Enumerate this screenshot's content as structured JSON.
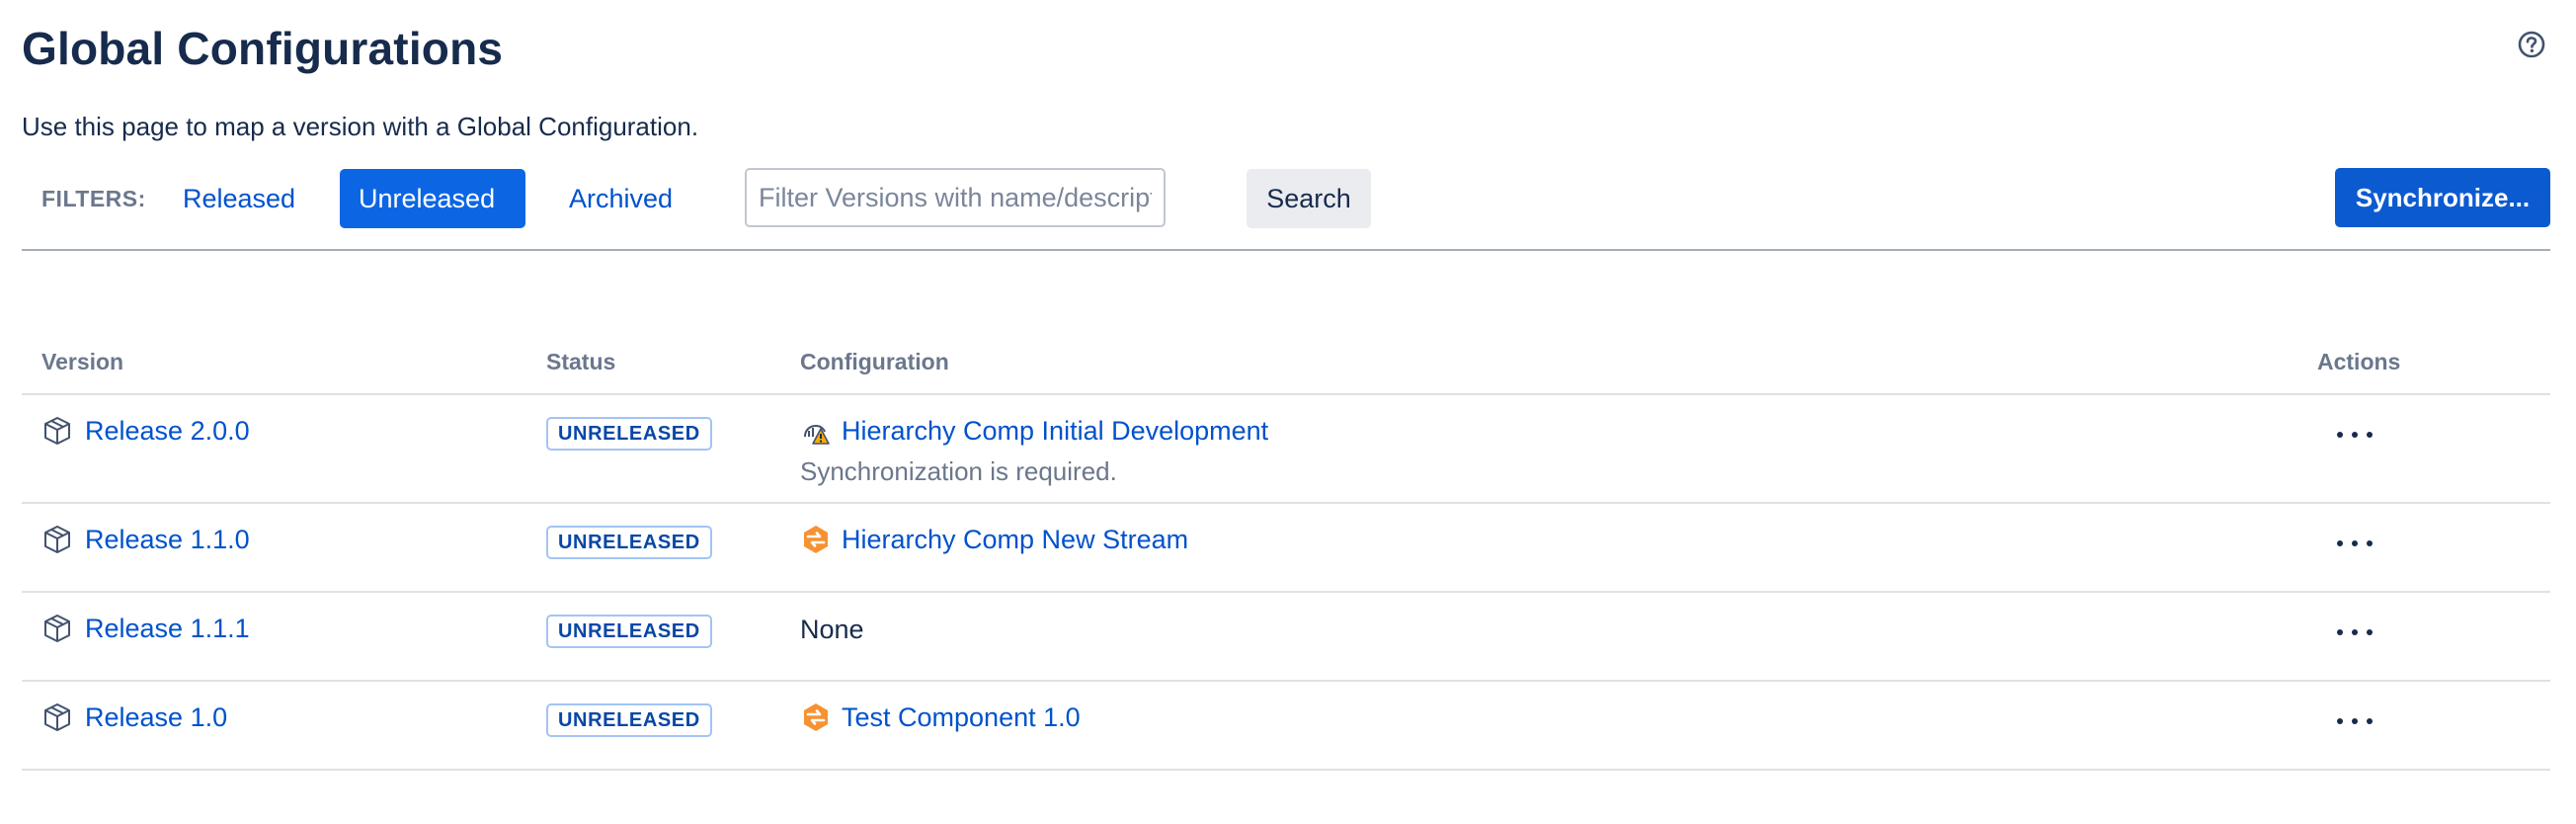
{
  "page": {
    "title": "Global Configurations",
    "subtitle": "Use this page to map a version with a Global Configuration.",
    "help_icon": "question-circle-icon"
  },
  "filters": {
    "label": "FILTERS:",
    "options": [
      {
        "label": "Released",
        "active": false
      },
      {
        "label": "Unreleased",
        "active": true
      },
      {
        "label": "Archived",
        "active": false
      }
    ],
    "search_placeholder": "Filter Versions with name/description",
    "search_value": "",
    "search_button": "Search",
    "synchronize_button": "Synchronize...",
    "active_color": "#0c66e4"
  },
  "table": {
    "headers": {
      "version": "Version",
      "status": "Status",
      "configuration": "Configuration",
      "actions": "Actions"
    },
    "rows": [
      {
        "version": "Release 2.0.0",
        "status": "UNRELEASED",
        "configuration": "Hierarchy Comp Initial Development",
        "config_icon": "config-warning-icon",
        "note": "Synchronization is required."
      },
      {
        "version": "Release 1.1.0",
        "status": "UNRELEASED",
        "configuration": "Hierarchy Comp New Stream",
        "config_icon": "stream-icon"
      },
      {
        "version": "Release 1.1.1",
        "status": "UNRELEASED",
        "configuration": "None",
        "config_icon": null
      },
      {
        "version": "Release 1.0",
        "status": "UNRELEASED",
        "configuration": "Test Component 1.0",
        "config_icon": "stream-icon"
      }
    ],
    "version_icon": "package-icon",
    "actions_icon": "more-icon"
  },
  "colors": {
    "link": "#0052cc",
    "badge_text": "#0747a6",
    "badge_border": "#a2c4f5",
    "stream_orange": "#f79232",
    "primary_button": "#0c5ad0"
  }
}
